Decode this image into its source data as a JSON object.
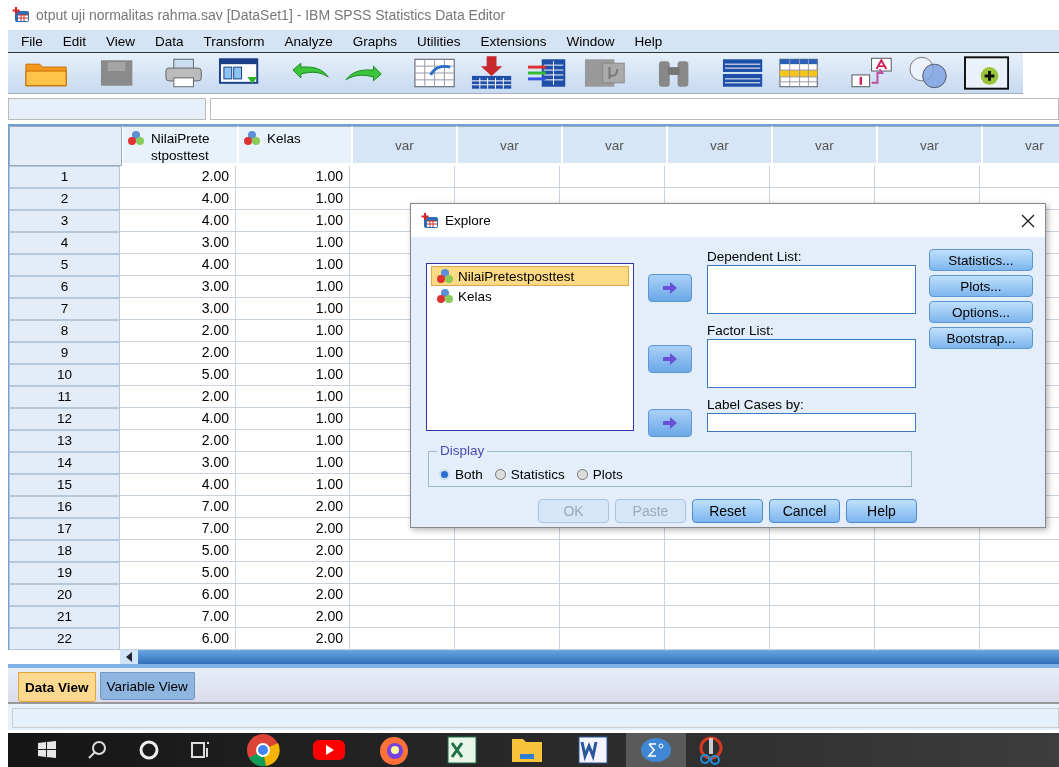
{
  "window": {
    "title": "otput uji normalitas rahma.sav [DataSet1] - IBM SPSS Statistics Data Editor"
  },
  "menu": [
    "File",
    "Edit",
    "View",
    "Data",
    "Transform",
    "Analyze",
    "Graphs",
    "Utilities",
    "Extensions",
    "Window",
    "Help"
  ],
  "grid": {
    "columns": [
      {
        "label": "NilaiPretestposttest",
        "kind": "variable"
      },
      {
        "label": "Kelas",
        "kind": "variable"
      },
      {
        "label": "var",
        "kind": "empty"
      },
      {
        "label": "var",
        "kind": "empty"
      },
      {
        "label": "var",
        "kind": "empty"
      },
      {
        "label": "var",
        "kind": "empty"
      },
      {
        "label": "var",
        "kind": "empty"
      },
      {
        "label": "var",
        "kind": "empty"
      },
      {
        "label": "var",
        "kind": "empty"
      }
    ],
    "rows": [
      {
        "number": "1",
        "cells": [
          "2.00",
          "1.00"
        ]
      },
      {
        "number": "2",
        "cells": [
          "4.00",
          "1.00"
        ]
      },
      {
        "number": "3",
        "cells": [
          "4.00",
          "1.00"
        ]
      },
      {
        "number": "4",
        "cells": [
          "3.00",
          "1.00"
        ]
      },
      {
        "number": "5",
        "cells": [
          "4.00",
          "1.00"
        ]
      },
      {
        "number": "6",
        "cells": [
          "3.00",
          "1.00"
        ]
      },
      {
        "number": "7",
        "cells": [
          "3.00",
          "1.00"
        ]
      },
      {
        "number": "8",
        "cells": [
          "2.00",
          "1.00"
        ]
      },
      {
        "number": "9",
        "cells": [
          "2.00",
          "1.00"
        ]
      },
      {
        "number": "10",
        "cells": [
          "5.00",
          "1.00"
        ]
      },
      {
        "number": "11",
        "cells": [
          "2.00",
          "1.00"
        ]
      },
      {
        "number": "12",
        "cells": [
          "4.00",
          "1.00"
        ]
      },
      {
        "number": "13",
        "cells": [
          "2.00",
          "1.00"
        ]
      },
      {
        "number": "14",
        "cells": [
          "3.00",
          "1.00"
        ]
      },
      {
        "number": "15",
        "cells": [
          "4.00",
          "1.00"
        ]
      },
      {
        "number": "16",
        "cells": [
          "7.00",
          "2.00"
        ]
      },
      {
        "number": "17",
        "cells": [
          "7.00",
          "2.00"
        ]
      },
      {
        "number": "18",
        "cells": [
          "5.00",
          "2.00"
        ]
      },
      {
        "number": "19",
        "cells": [
          "5.00",
          "2.00"
        ]
      },
      {
        "number": "20",
        "cells": [
          "6.00",
          "2.00"
        ]
      },
      {
        "number": "21",
        "cells": [
          "7.00",
          "2.00"
        ]
      },
      {
        "number": "22",
        "cells": [
          "6.00",
          "2.00"
        ]
      }
    ]
  },
  "view_tabs": [
    {
      "label": "Data View",
      "selected": true
    },
    {
      "label": "Variable View",
      "selected": false
    }
  ],
  "dialog": {
    "title": "Explore",
    "source_list": [
      {
        "label": "NilaiPretestposttest",
        "selected": true
      },
      {
        "label": "Kelas",
        "selected": false
      }
    ],
    "targets": [
      {
        "label": "Dependent List:",
        "kind": "list"
      },
      {
        "label": "Factor List:",
        "kind": "list"
      },
      {
        "label": "Label Cases by:",
        "kind": "field"
      }
    ],
    "side_buttons": [
      "Statistics...",
      "Plots...",
      "Options...",
      "Bootstrap..."
    ],
    "display": {
      "label": "Display",
      "options": [
        {
          "label": "Both",
          "selected": true
        },
        {
          "label": "Statistics",
          "selected": false
        },
        {
          "label": "Plots",
          "selected": false
        }
      ]
    },
    "buttons": [
      {
        "label": "OK",
        "disabled": true
      },
      {
        "label": "Paste",
        "disabled": true
      },
      {
        "label": "Reset",
        "disabled": false
      },
      {
        "label": "Cancel",
        "disabled": false
      },
      {
        "label": "Help",
        "disabled": false
      }
    ]
  }
}
